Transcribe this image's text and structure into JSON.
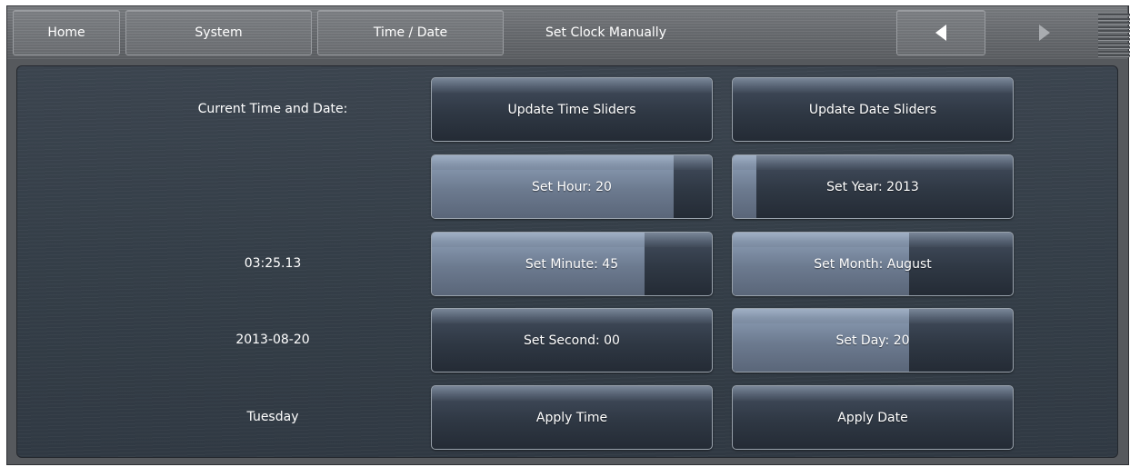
{
  "nav": {
    "home": "Home",
    "system": "System",
    "time_date": "Time / Date",
    "current": "Set Clock Manually"
  },
  "icons": {
    "back": "left-triangle-arrow",
    "forward": "right-triangle-arrow",
    "menu": "hamburger-menu"
  },
  "info": {
    "heading": "Current Time and Date:",
    "time": "03:25.13",
    "date": "2013-08-20",
    "weekday": "Tuesday"
  },
  "buttons": {
    "update_time": "Update Time Sliders",
    "update_date": "Update Date Sliders",
    "apply_time": "Apply Time",
    "apply_date": "Apply Date"
  },
  "sliders": {
    "hour": {
      "label": "Set Hour: 20",
      "fraction": 0.865
    },
    "minute": {
      "label": "Set Minute: 45",
      "fraction": 0.76
    },
    "second": {
      "label": "Set Second: 00",
      "fraction": 0.0
    },
    "year": {
      "label": "Set Year: 2013",
      "fraction": 0.085
    },
    "month": {
      "label": "Set Month: August",
      "fraction": 0.63
    },
    "day": {
      "label": "Set Day: 20",
      "fraction": 0.63
    }
  },
  "colors": {
    "slider_fill": "#8494ab",
    "panel_bg": "#36404a",
    "topbar_bg": "#6a6d71"
  }
}
